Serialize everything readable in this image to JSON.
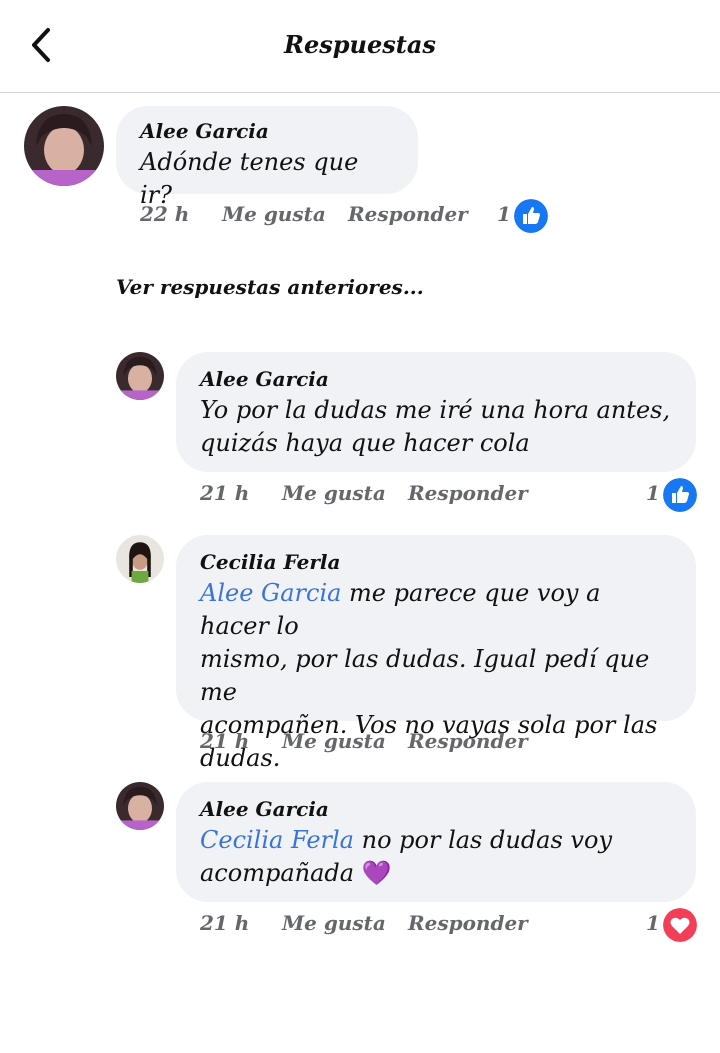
{
  "header": {
    "title": "Respuestas"
  },
  "parent_comment": {
    "author": "Alee Garcia",
    "text": "Adónde tenes que ir?",
    "time": "22 h",
    "like_label": "Me gusta",
    "reply_label": "Responder",
    "reaction_count": "1",
    "reaction": "like-icon"
  },
  "see_previous": "Ver respuestas anteriores...",
  "replies": [
    {
      "author": "Alee Garcia",
      "line1": "Yo por la dudas me iré una hora antes,",
      "line2": "quizás haya que hacer cola",
      "time": "21 h",
      "like_label": "Me gusta",
      "reply_label": "Responder",
      "reaction_count": "1",
      "reaction": "like-icon"
    },
    {
      "author": "Cecilia Ferla",
      "mention": "Alee Garcia",
      "line1_rest": " me parece que voy a hacer lo",
      "line2": "mismo, por las dudas. Igual pedí que me",
      "line3": "acompañen. Vos no vayas sola por las",
      "line4": "dudas.",
      "time": "21 h",
      "like_label": "Me gusta",
      "reply_label": "Responder"
    },
    {
      "author": "Alee Garcia",
      "mention": "Cecilia Ferla",
      "line1_rest": " no por las dudas voy",
      "line2": "acompañada",
      "emoji": "💜",
      "time": "21 h",
      "like_label": "Me gusta",
      "reply_label": "Responder",
      "reaction_count": "1",
      "reaction": "love-icon"
    }
  ],
  "colors": {
    "like_blue": "#1877f2",
    "love_red": "#f33e58",
    "mention_blue": "#3b74d4",
    "bubble_bg": "#f0f2f5"
  }
}
